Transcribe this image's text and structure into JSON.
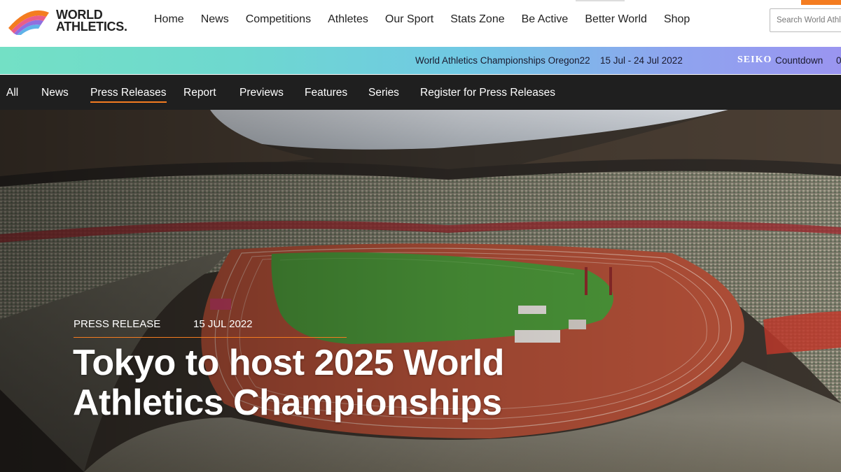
{
  "header": {
    "logo_line1": "WORLD",
    "logo_line2": "ATHLETICS.",
    "nav": [
      "Home",
      "News",
      "Competitions",
      "Athletes",
      "Our Sport",
      "Stats Zone",
      "Be Active",
      "Better World",
      "Shop"
    ],
    "search_placeholder": "Search World Athl"
  },
  "ticker": {
    "event": "World Athletics Championships Oregon22",
    "dates": "15 Jul - 24 Jul 2022",
    "sponsor": "SEIKO",
    "countdown_label": "Countdown",
    "countdown_value": "0"
  },
  "subnav": {
    "items": [
      "All",
      "News",
      "Press Releases",
      "Report",
      "Previews",
      "Features",
      "Series",
      "Register for Press Releases"
    ],
    "active": "Press Releases"
  },
  "article": {
    "type": "PRESS RELEASE",
    "date": "15 JUL 2022",
    "title_line1": "Tokyo to host 2025 World",
    "title_line2": "Athletics Championships"
  },
  "colors": {
    "accent": "#f47c20",
    "subnav_bg": "#1f1f1f",
    "track": "#b5503a",
    "field": "#4d9a3a"
  }
}
